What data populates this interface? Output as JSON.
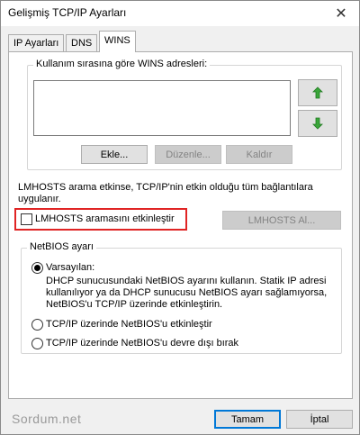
{
  "window": {
    "title": "Gelişmiş TCP/IP Ayarları",
    "close_glyph": "✕"
  },
  "tabs": [
    {
      "label": "IP Ayarları"
    },
    {
      "label": "DNS"
    },
    {
      "label": "WINS"
    }
  ],
  "wins_group": {
    "label": "Kullanım sırasına göre WINS adresleri:",
    "up_icon": "arrow-up-green-icon",
    "down_icon": "arrow-down-green-icon",
    "add_label": "Ekle...",
    "edit_label": "Düzenle...",
    "remove_label": "Kaldır"
  },
  "lmhosts": {
    "description": "LMHOSTS arama etkinse, TCP/IP'nin etkin olduğu tüm bağlantılara uygulanır.",
    "checkbox_label": "LMHOSTS aramasını etkinleştir",
    "checked": false,
    "button_label": "LMHOSTS Al...",
    "highlight_color": "#e02424"
  },
  "netbios": {
    "legend": "NetBIOS ayarı",
    "default_label": "Varsayılan:",
    "default_description_1": "DHCP sunucusundaki NetBIOS ayarını kullanın. Statik IP adresi",
    "default_description_2": "kullanılıyor ya da DHCP sunucusu NetBIOS ayarı sağlamıyorsa,",
    "default_description_3": "NetBIOS'u TCP/IP üzerinde etkinleştirin.",
    "enable_label": "TCP/IP üzerinde NetBIOS'u etkinleştir",
    "disable_label": "TCP/IP üzerinde NetBIOS'u devre dışı bırak",
    "selected": "default"
  },
  "footer": {
    "watermark": "Sordum.net",
    "ok_label": "Tamam",
    "cancel_label": "İptal"
  }
}
